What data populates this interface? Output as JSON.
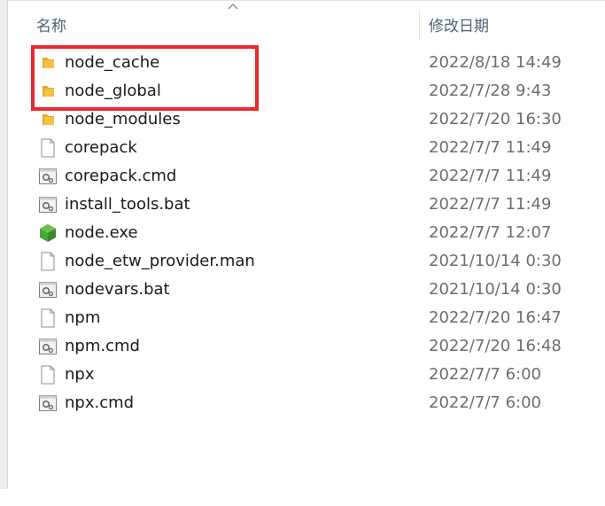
{
  "header": {
    "name_label": "名称",
    "date_label": "修改日期",
    "sort_icon": "sort-ascending-chevron-icon"
  },
  "files": [
    {
      "name": "node_cache",
      "date": "2022/8/18 14:49",
      "type": "folder"
    },
    {
      "name": "node_global",
      "date": "2022/7/28 9:43",
      "type": "folder"
    },
    {
      "name": "node_modules",
      "date": "2022/7/20 16:30",
      "type": "folder"
    },
    {
      "name": "corepack",
      "date": "2022/7/7 11:49",
      "type": "file"
    },
    {
      "name": "corepack.cmd",
      "date": "2022/7/7 11:49",
      "type": "script"
    },
    {
      "name": "install_tools.bat",
      "date": "2022/7/7 11:49",
      "type": "script"
    },
    {
      "name": "node.exe",
      "date": "2022/7/7 12:07",
      "type": "exe"
    },
    {
      "name": "node_etw_provider.man",
      "date": "2021/10/14 0:30",
      "type": "file"
    },
    {
      "name": "nodevars.bat",
      "date": "2021/10/14 0:30",
      "type": "script"
    },
    {
      "name": "npm",
      "date": "2022/7/20 16:47",
      "type": "file"
    },
    {
      "name": "npm.cmd",
      "date": "2022/7/20 16:48",
      "type": "script"
    },
    {
      "name": "npx",
      "date": "2022/7/7 6:00",
      "type": "file"
    },
    {
      "name": "npx.cmd",
      "date": "2022/7/7 6:00",
      "type": "script"
    }
  ],
  "colors": {
    "folder": "#f4c244",
    "highlight": "#e8292e",
    "node_exe": "#4aa53a"
  }
}
